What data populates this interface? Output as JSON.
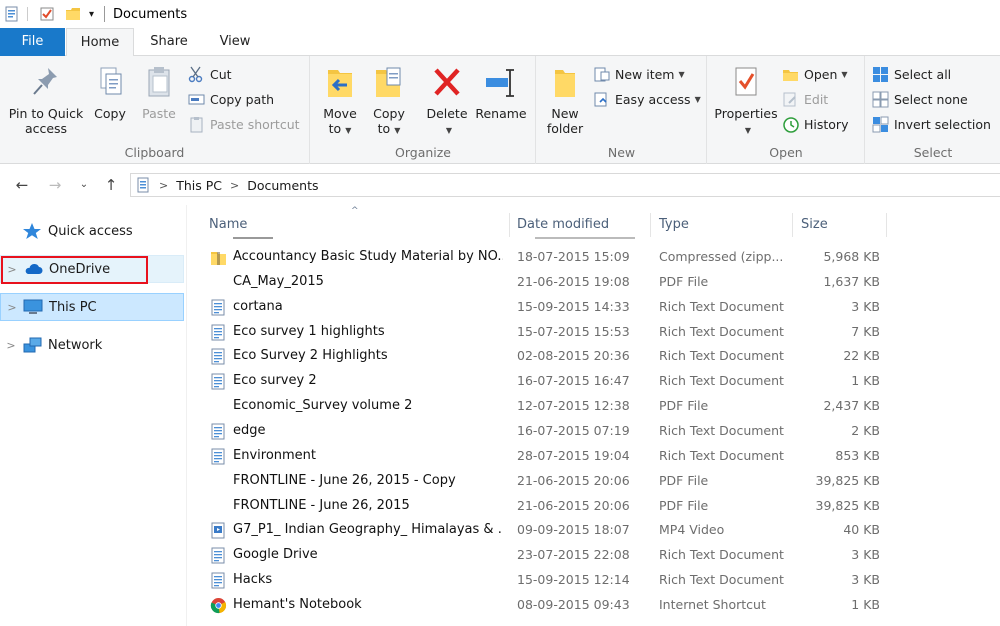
{
  "window": {
    "title": "Documents"
  },
  "ribbon_tabs": {
    "file": "File",
    "home": "Home",
    "share": "Share",
    "view": "View"
  },
  "clipboard": {
    "pin": "Pin to Quick access",
    "pin_l1": "Pin to Quick",
    "pin_l2": "access",
    "copy": "Copy",
    "paste": "Paste",
    "cut": "Cut",
    "copy_path": "Copy path",
    "paste_shortcut": "Paste shortcut",
    "label": "Clipboard"
  },
  "organize": {
    "move_l1": "Move",
    "move_l2": "to",
    "copy_l1": "Copy",
    "copy_l2": "to",
    "delete": "Delete",
    "rename": "Rename",
    "label": "Organize"
  },
  "new": {
    "folder_l1": "New",
    "folder_l2": "folder",
    "new_item": "New item",
    "easy_access": "Easy access",
    "label": "New"
  },
  "open": {
    "properties": "Properties",
    "open": "Open",
    "edit": "Edit",
    "history": "History",
    "label": "Open"
  },
  "select": {
    "select_all": "Select all",
    "select_none": "Select none",
    "invert": "Invert selection",
    "label": "Select"
  },
  "address": {
    "crumbs": [
      "This PC",
      "Documents"
    ]
  },
  "nav_pane": {
    "items": [
      {
        "label": "Quick access",
        "icon": "star-icon"
      },
      {
        "label": "OneDrive",
        "icon": "cloud-icon"
      },
      {
        "label": "This PC",
        "icon": "computer-icon"
      },
      {
        "label": "Network",
        "icon": "network-icon"
      }
    ]
  },
  "columns": {
    "name": "Name",
    "date": "Date modified",
    "type": "Type",
    "size": "Size"
  },
  "files": [
    {
      "name": "Accountancy Basic Study Material by NO...",
      "date": "18-07-2015 15:09",
      "type": "Compressed (zipp...",
      "size": "5,968 KB",
      "icon": "zip"
    },
    {
      "name": "CA_May_2015",
      "date": "21-06-2015 19:08",
      "type": "PDF File",
      "size": "1,637 KB",
      "icon": "none"
    },
    {
      "name": "cortana",
      "date": "15-09-2015 14:33",
      "type": "Rich Text Document",
      "size": "3 KB",
      "icon": "rtf"
    },
    {
      "name": "Eco survey 1 highlights",
      "date": "15-07-2015 15:53",
      "type": "Rich Text Document",
      "size": "7 KB",
      "icon": "rtf"
    },
    {
      "name": "Eco Survey 2 Highlights",
      "date": "02-08-2015 20:36",
      "type": "Rich Text Document",
      "size": "22 KB",
      "icon": "rtf"
    },
    {
      "name": "Eco survey 2",
      "date": "16-07-2015 16:47",
      "type": "Rich Text Document",
      "size": "1 KB",
      "icon": "rtf"
    },
    {
      "name": "Economic_Survey volume 2",
      "date": "12-07-2015 12:38",
      "type": "PDF File",
      "size": "2,437 KB",
      "icon": "none"
    },
    {
      "name": "edge",
      "date": "16-07-2015 07:19",
      "type": "Rich Text Document",
      "size": "2 KB",
      "icon": "rtf"
    },
    {
      "name": "Environment",
      "date": "28-07-2015 19:04",
      "type": "Rich Text Document",
      "size": "853 KB",
      "icon": "rtf"
    },
    {
      "name": "FRONTLINE - June 26, 2015 - Copy",
      "date": "21-06-2015 20:06",
      "type": "PDF File",
      "size": "39,825 KB",
      "icon": "none"
    },
    {
      "name": "FRONTLINE - June 26, 2015",
      "date": "21-06-2015 20:06",
      "type": "PDF File",
      "size": "39,825 KB",
      "icon": "none"
    },
    {
      "name": "G7_P1_ Indian Geography_ Himalayas & ...",
      "date": "09-09-2015 18:07",
      "type": "MP4 Video",
      "size": "40 KB",
      "icon": "video"
    },
    {
      "name": "Google Drive",
      "date": "23-07-2015 22:08",
      "type": "Rich Text Document",
      "size": "3 KB",
      "icon": "rtf"
    },
    {
      "name": "Hacks",
      "date": "15-09-2015 12:14",
      "type": "Rich Text Document",
      "size": "3 KB",
      "icon": "rtf"
    },
    {
      "name": "Hemant's Notebook",
      "date": "08-09-2015 09:43",
      "type": "Internet Shortcut",
      "size": "1 KB",
      "icon": "chrome"
    }
  ],
  "colors": {
    "accent": "#1979ca",
    "highlight_box": "#e8111d",
    "selected_bg": "#cce8ff"
  }
}
